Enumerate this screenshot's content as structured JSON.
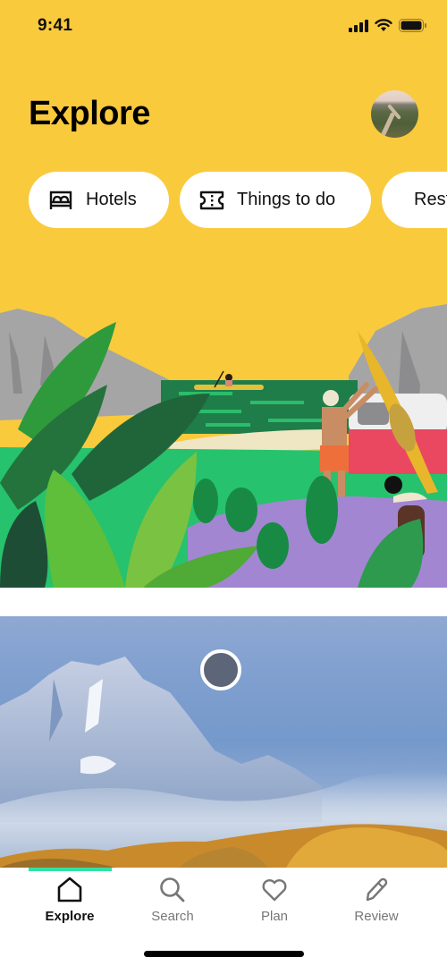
{
  "status_bar": {
    "time": "9:41",
    "icons": [
      "cellular-signal-icon",
      "wifi-icon",
      "battery-icon"
    ]
  },
  "header": {
    "title": "Explore",
    "avatar": "profile-avatar"
  },
  "categories": [
    {
      "label": "Hotels",
      "icon": "bed-icon"
    },
    {
      "label": "Things to do",
      "icon": "ticket-icon"
    },
    {
      "label": "Restaurants",
      "icon": "fork-knife-icon"
    }
  ],
  "hero": {
    "illustration": "tropical-lake-kayak-illustration"
  },
  "feature_photo": {
    "subject": "snowy-mountain-autumn-trees-photo",
    "indicator": "recording-dot"
  },
  "tabbar": {
    "active": "Explore",
    "tabs": [
      {
        "label": "Explore",
        "icon": "home-icon"
      },
      {
        "label": "Search",
        "icon": "search-icon"
      },
      {
        "label": "Plan",
        "icon": "heart-icon"
      },
      {
        "label": "Review",
        "icon": "pencil-icon"
      }
    ]
  },
  "colors": {
    "brand_yellow": "#FACA3D",
    "accent_green": "#34E0A1",
    "text_primary": "#111111",
    "text_secondary": "#777777"
  }
}
